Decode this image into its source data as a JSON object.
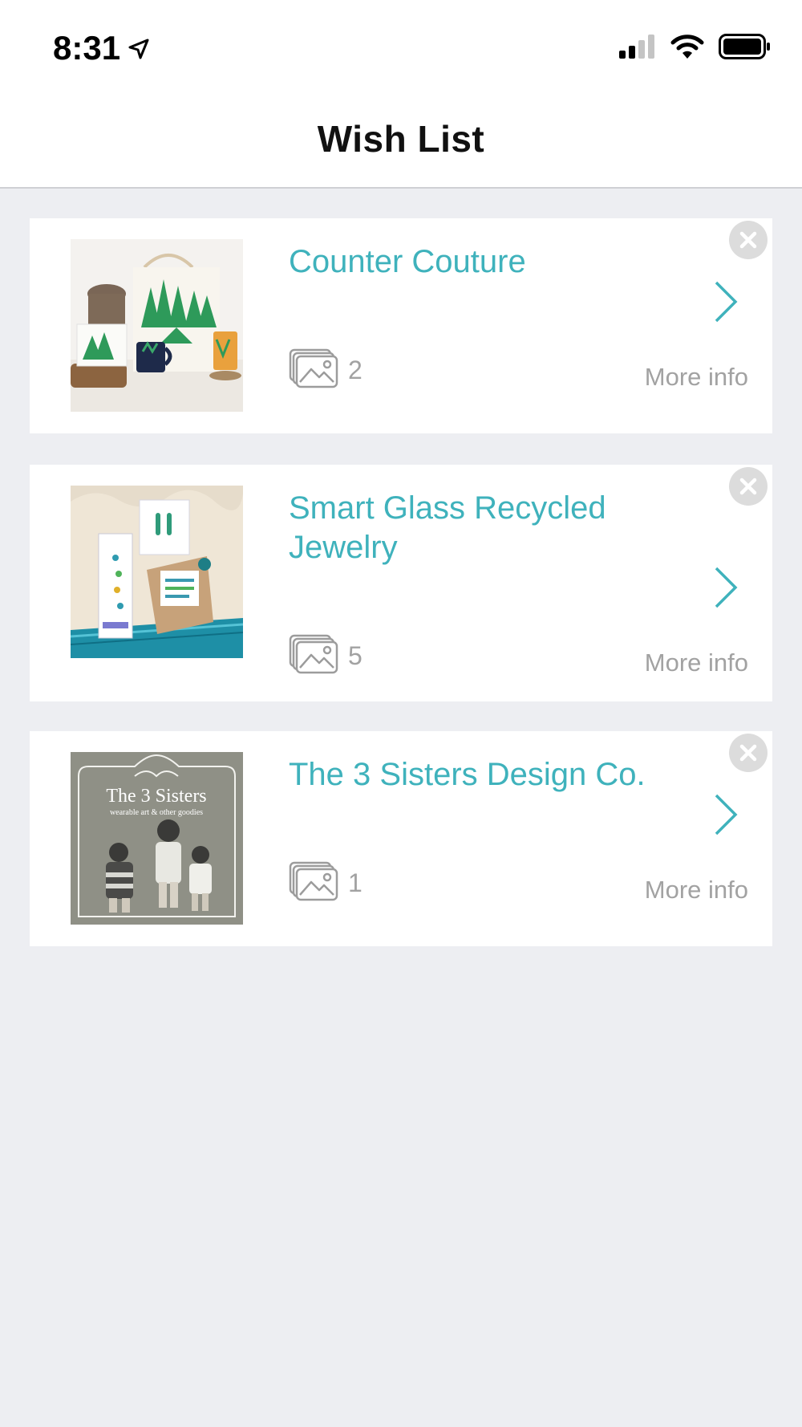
{
  "status_bar": {
    "time": "8:31",
    "location_icon": "location-arrow-icon",
    "signal_icon": "cellular-signal-icon",
    "wifi_icon": "wifi-icon",
    "battery_icon": "battery-icon"
  },
  "header": {
    "title": "Wish List"
  },
  "colors": {
    "accent": "#3fb2bc",
    "muted": "#a2a2a2",
    "background": "#edeef2"
  },
  "wishlist": [
    {
      "title": "Counter Couture",
      "photo_count": "2",
      "more_info_label": "More info",
      "thumbnail": "counter-couture-products-thumbnail"
    },
    {
      "title": "Smart Glass Recycled Jewelry",
      "photo_count": "5",
      "more_info_label": "More info",
      "thumbnail": "smart-glass-jewelry-thumbnail"
    },
    {
      "title": "The 3 Sisters Design Co.",
      "photo_count": "1",
      "more_info_label": "More info",
      "thumbnail": "three-sisters-logo-thumbnail",
      "thumbnail_text": {
        "name": "The 3 Sisters",
        "tagline": "wearable art & other goodies"
      }
    }
  ]
}
